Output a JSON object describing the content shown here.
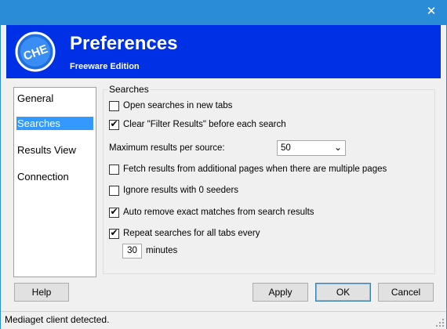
{
  "window": {
    "close_glyph": "✕"
  },
  "banner": {
    "logo_text": "CHE",
    "title": "Preferences",
    "subtitle": "Freeware Edition"
  },
  "nav": {
    "items": [
      {
        "label": "General",
        "selected": false
      },
      {
        "label": "Searches",
        "selected": true
      },
      {
        "label": "Results View",
        "selected": false
      },
      {
        "label": "Connection",
        "selected": false
      }
    ]
  },
  "searches": {
    "group_label": "Searches",
    "open_new_tabs": {
      "label": "Open searches in new tabs",
      "checked": false
    },
    "clear_filter": {
      "label": "Clear \"Filter Results\" before each search",
      "checked": true
    },
    "max_results_label": "Maximum results per source:",
    "max_results_value": "50",
    "fetch_additional": {
      "label": "Fetch results from additional pages when there are multiple pages",
      "checked": false
    },
    "ignore_zero_seeders": {
      "label": "Ignore results with 0 seeders",
      "checked": false
    },
    "auto_remove": {
      "label": "Auto remove exact matches from search results",
      "checked": true
    },
    "repeat_searches": {
      "label": "Repeat searches for all tabs every",
      "checked": true
    },
    "repeat_minutes_value": "30",
    "minutes_label": "minutes"
  },
  "buttons": {
    "help": "Help",
    "apply": "Apply",
    "ok": "OK",
    "cancel": "Cancel"
  },
  "status": {
    "text": "Mediaget client detected."
  },
  "icons": {
    "close": "close-icon",
    "check": "check-icon",
    "dropdown": "chevron-down-icon",
    "logo": "che-logo-icon",
    "grip": "resize-grip-icon"
  },
  "colors": {
    "titlebar": "#2a8bd6",
    "banner": "#0030e6",
    "selection": "#3399ff"
  }
}
